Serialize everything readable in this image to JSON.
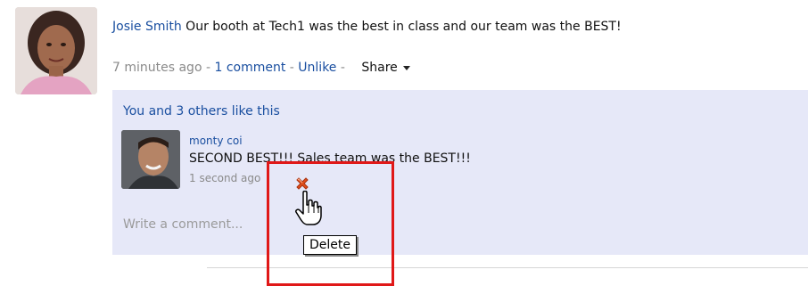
{
  "post": {
    "author": "Josie Smith",
    "text": "Our booth at Tech1 was the best in class and our team was the BEST!",
    "time": "7 minutes ago",
    "sep1": " - ",
    "comment_link": "1 comment",
    "sep2": " - ",
    "unlike_link": "Unlike",
    "sep3": " - ",
    "share_label": "Share"
  },
  "comments": {
    "likes_text": "You and 3 others like this",
    "items": [
      {
        "author": "monty coi",
        "text": "SECOND BEST!!! Sales team was the BEST!!!",
        "time": "1 second ago"
      }
    ],
    "write_placeholder": "Write a comment..."
  },
  "tooltip": {
    "text": "Delete"
  },
  "icons": {
    "delete": "delete-x-icon",
    "share_caret": "caret-down-icon",
    "cursor": "hand-pointer-icon"
  },
  "colors": {
    "link": "#1a4fa0",
    "comment_bg": "#e6e8f8",
    "highlight": "#e01818",
    "delete_icon": "#e2501c"
  }
}
